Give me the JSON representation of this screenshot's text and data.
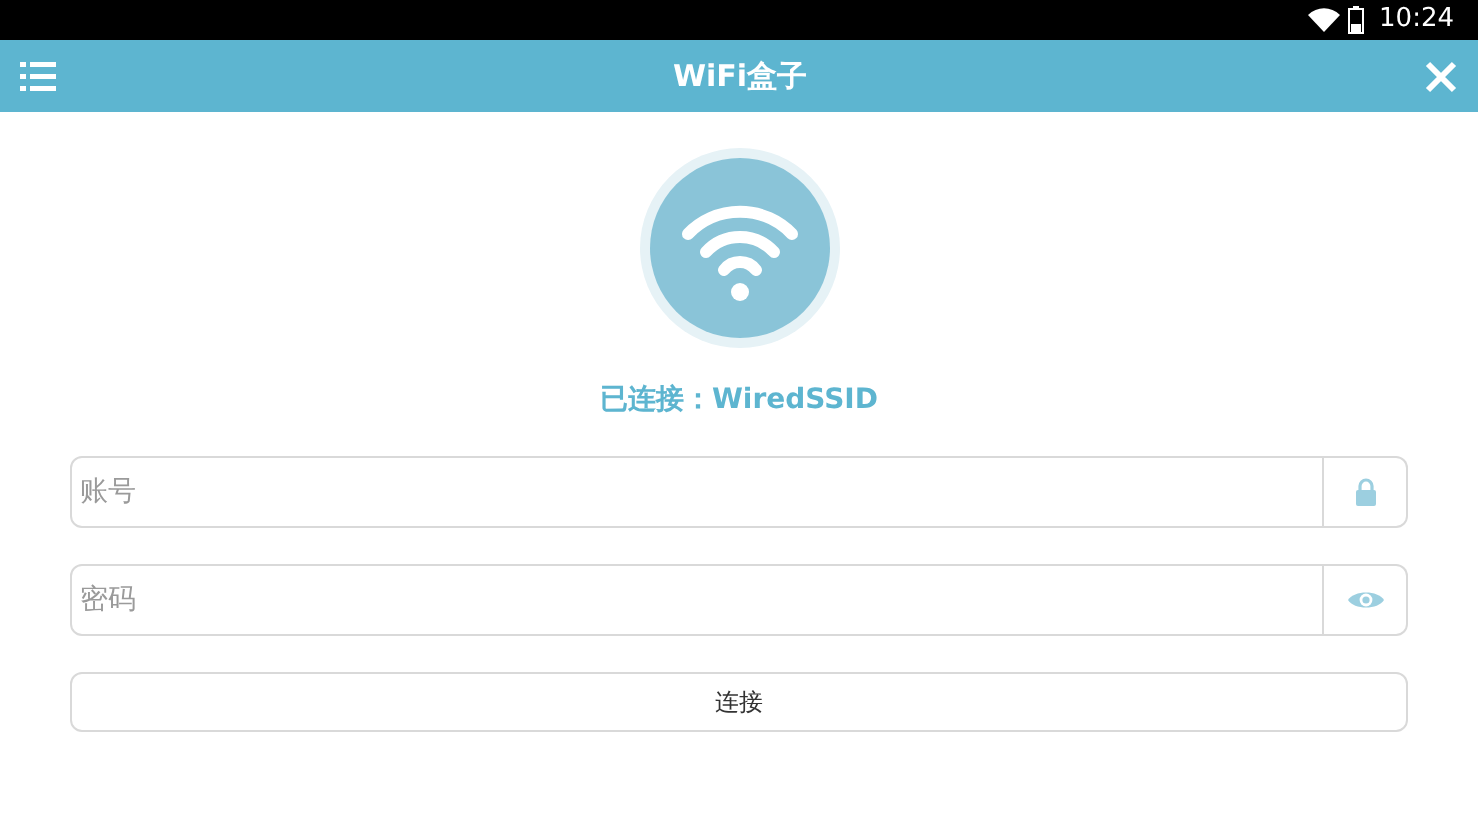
{
  "status_bar": {
    "time": "10:24"
  },
  "header": {
    "title": "WiFi盒子"
  },
  "connection": {
    "label": "已连接：WiredSSID"
  },
  "fields": [
    {
      "placeholder": "账号",
      "kind": "lock"
    },
    {
      "placeholder": "密码",
      "kind": "eye"
    }
  ],
  "button": {
    "label": "连接"
  }
}
